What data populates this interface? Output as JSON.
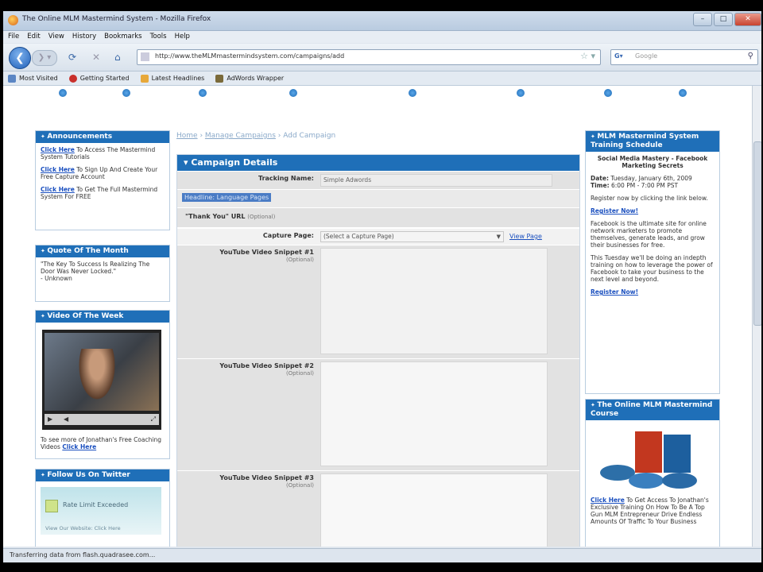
{
  "window": {
    "title": "The Online MLM Mastermind System - Mozilla Firefox"
  },
  "menu": [
    "File",
    "Edit",
    "View",
    "History",
    "Bookmarks",
    "Tools",
    "Help"
  ],
  "nav": {
    "url": "http://www.theMLMmastermindsystem.com/campaigns/add",
    "search_placeholder": "Google"
  },
  "bookmarks": [
    {
      "label": "Most Visited",
      "color": "#5b86c4"
    },
    {
      "label": "Getting Started",
      "color": "#c9302c"
    },
    {
      "label": "Latest Headlines",
      "color": "#e7a83a"
    },
    {
      "label": "AdWords Wrapper",
      "color": "#7a6a3a"
    }
  ],
  "left": {
    "announcements": {
      "title": "Announcements",
      "items": [
        {
          "link": "Click Here",
          "text": " To Access The Mastermind System Tutorials"
        },
        {
          "link": "Click Here",
          "text": " To Sign Up And Create Your Free Capture Account"
        },
        {
          "link": "Click Here",
          "text": " To Get The Full Mastermind System For FREE"
        }
      ]
    },
    "quote": {
      "title": "Quote Of The Month",
      "text": "\"The Key To Success Is Realizing The Door Was Never Locked.\"",
      "author": "- Unknown"
    },
    "video": {
      "title": "Video Of The Week",
      "caption": "To see more of Jonathan's Free Coaching Videos ",
      "caption_link": "Click Here"
    },
    "twitter": {
      "title": "Follow Us On Twitter",
      "inner": "Rate Limit Exceeded",
      "footer": "View Our Website: Click Here"
    }
  },
  "breadcrumb": {
    "home": "Home",
    "sep1": " › ",
    "campaigns": "Manage Campaigns",
    "sep2": " › ",
    "current": "Add Campaign"
  },
  "campaign": {
    "title": "Campaign Details",
    "tracking_label": "Tracking Name:",
    "tracking_value": "Simple Adwords",
    "highlight": "Headline: Language Pages",
    "thankyou_label": "\"Thank You\" URL",
    "thankyou_opt": "(Optional)",
    "capture_label": "Capture Page:",
    "capture_select": "(Select a Capture Page)",
    "capture_link": "View Page",
    "yt1_label": "YouTube Video Snippet #1",
    "yt2_label": "YouTube Video Snippet #2",
    "yt3_label": "YouTube Video Snippet #3",
    "yt_opt": "(Optional)"
  },
  "right": {
    "training": {
      "title": "MLM Mastermind System Training Schedule",
      "subtitle": "Social Media Mastery - Facebook Marketing Secrets",
      "date_label": "Date:",
      "date_value": " Tuesday, January 6th, 2009",
      "time_label": "Time:",
      "time_value": " 6:00 PM - 7:00 PM PST",
      "register": "Register now by clicking the link below.",
      "link1": "Register Now!",
      "desc1": "Facebook is the ultimate site for online network marketers to promote themselves, generate leads, and grow their businesses for free.",
      "desc2": "This Tuesday we'll be doing an indepth training on how to leverage the power of Facebook to take your business to the next level and beyond.",
      "link2": "Register Now!"
    },
    "course": {
      "title": "The Online MLM Mastermind Course",
      "link": "Click Here",
      "text": " To Get Access To Jonathan's Exclusive Training On How To Be A Top Gun MLM Entrepreneur Drive Endless Amounts Of Traffic To Your Business"
    }
  },
  "status": {
    "text": "Transferring data from flash.quadrasee.com..."
  }
}
